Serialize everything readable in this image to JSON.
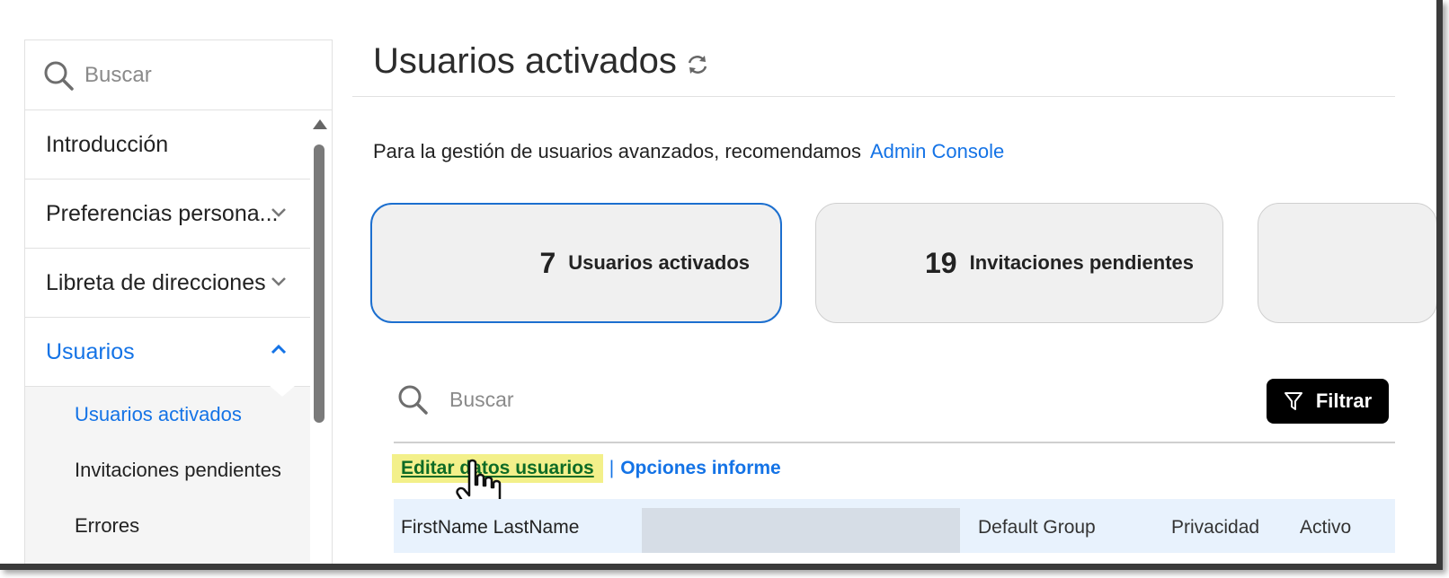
{
  "sidebar": {
    "search_placeholder": "Buscar",
    "items": [
      {
        "label": "Introducción"
      },
      {
        "label": "Preferencias persona..."
      },
      {
        "label": "Libreta de direcciones"
      },
      {
        "label": "Usuarios"
      }
    ],
    "sub_items": [
      {
        "label": "Usuarios activados"
      },
      {
        "label": "Invitaciones pendientes"
      },
      {
        "label": "Errores"
      }
    ]
  },
  "main": {
    "title": "Usuarios activados",
    "intro_text": "Para la gestión de usuarios avanzados, recomendamos",
    "intro_link": "Admin Console",
    "cards": [
      {
        "count": "7",
        "label": "Usuarios activados"
      },
      {
        "count": "19",
        "label": "Invitaciones pendientes"
      }
    ],
    "search_placeholder": "Buscar",
    "filter_label": "Filtrar",
    "edit_link": "Editar datos usuarios",
    "separator": "|",
    "options_link": "Opciones informe",
    "table_headers": {
      "name": "FirstName LastName",
      "group": "Default Group",
      "privacy": "Privacidad",
      "active": "Activo"
    }
  },
  "colors": {
    "accent": "#1473e6",
    "highlight": "#f3f08a",
    "edit_link_text": "#0d6b25",
    "table_header_bg": "#e8f2fd"
  },
  "icons": [
    "search-icon",
    "chevron-down-icon",
    "chevron-up-icon",
    "refresh-icon",
    "filter-icon",
    "hand-pointer-icon"
  ]
}
